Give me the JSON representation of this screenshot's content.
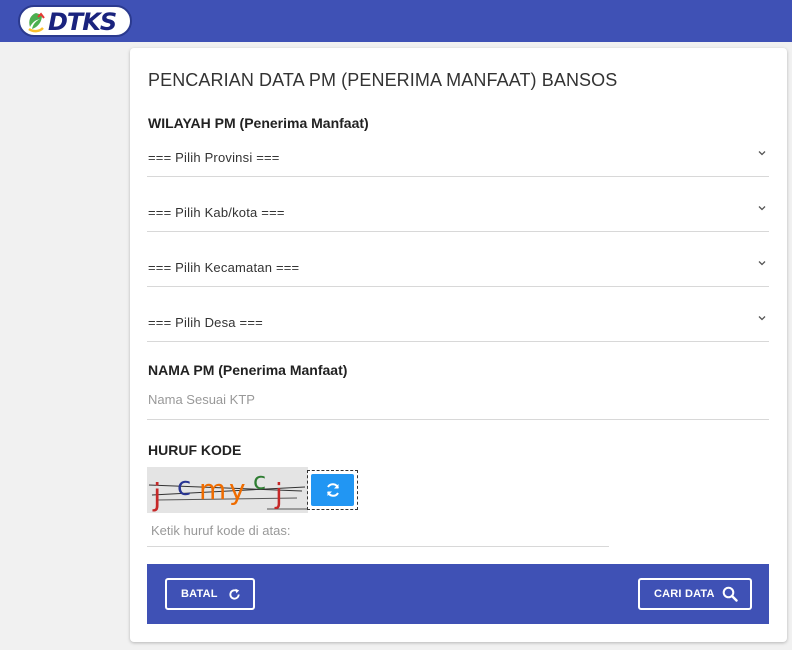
{
  "header": {
    "logo_text": "DTKS"
  },
  "form": {
    "title": "PENCARIAN DATA PM (PENERIMA MANFAAT) BANSOS",
    "wilayah_label": "WILAYAH PM (Penerima Manfaat)",
    "selects": {
      "provinsi": "=== Pilih Provinsi ===",
      "kabkota": "=== Pilih Kab/kota ===",
      "kecamatan": "=== Pilih Kecamatan ===",
      "desa": "=== Pilih Desa ==="
    },
    "nama_label": "NAMA PM (Penerima Manfaat)",
    "nama_placeholder": "Nama Sesuai KTP",
    "kode_label": "HURUF KODE",
    "captcha_text": "jcmycj",
    "captcha_placeholder": "Ketik huruf kode di atas:"
  },
  "actions": {
    "batal_label": "BATAL",
    "cari_label": "CARI DATA"
  },
  "colors": {
    "primary": "#3f51b5",
    "refresh": "#2196f3"
  },
  "icons": {
    "batal": "refresh-icon",
    "cari": "search-icon",
    "captcha_refresh": "sync-icon",
    "select": "chevron-down-icon"
  }
}
